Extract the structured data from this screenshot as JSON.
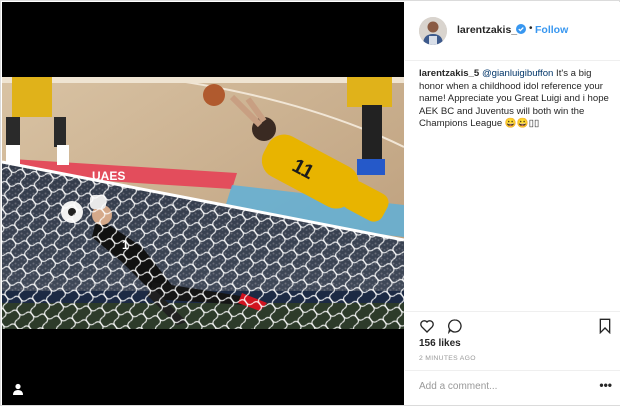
{
  "post": {
    "username": "larentzakis_5",
    "follow_label": "Follow",
    "separator": "•",
    "caption": {
      "username": "larentzakis_5",
      "mention": "@gianluigibuffon",
      "text": " It's a big honor when a childhood idol reference your name! Appreciate you Great Luigi and i hope AEK BC and Juventus will both win the Champions League 😀😀▯▯"
    },
    "likes": "156 likes",
    "time_ago": "2 MINUTES AGO",
    "comment_placeholder": "Add a comment...",
    "more_label": "•••"
  },
  "media": {
    "arena_sign": "UAES",
    "jersey_number": "11",
    "goalie_number": "1"
  },
  "colors": {
    "follow": "#3897f0",
    "text": "#262626",
    "muted": "#999999",
    "border": "#efefef",
    "basketball_jersey": "#e8b400",
    "goalkeeper_boot": "#d1121f"
  },
  "icons": [
    "tag-icon",
    "verified-badge-icon",
    "heart-icon",
    "comment-icon",
    "bookmark-icon"
  ]
}
